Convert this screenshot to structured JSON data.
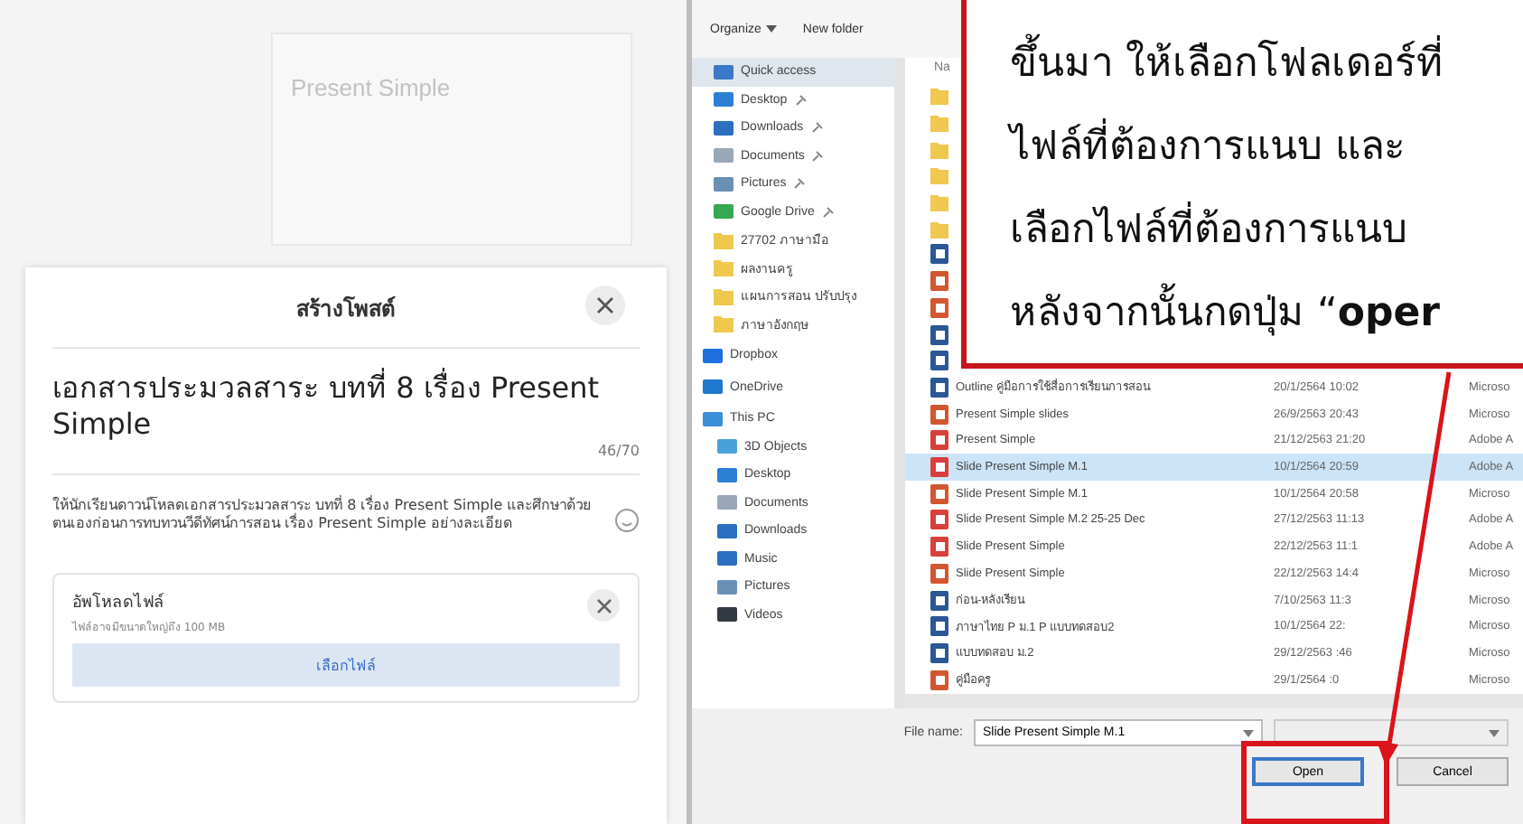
{
  "course_card": {
    "title": "Present Simple"
  },
  "post_dialog": {
    "title": "สร้างโพสต์",
    "post_title": "เอกสารประมวลสาระ บทที่ 8 เรื่อง Present Simple",
    "counter": "46/70",
    "description": "ให้นักเรียนดาวน์โหลดเอกสารประมวลสาระ บทที่ 8 เรื่อง Present Simple และศึกษาด้วยตนเองก่อนการทบทวนวีดีทัศน์การสอน เรื่อง Present Simple อย่างละเอียด",
    "attachment": {
      "title": "อัพโหลดไฟล์",
      "note": "ไฟล์อาจมีขนาดใหญ่ถึง 100 MB",
      "button": "เลือกไฟล์"
    }
  },
  "file_dialog": {
    "toolbar": {
      "organize": "Organize",
      "new_folder": "New folder"
    },
    "name_header": "Na",
    "sidebar": [
      {
        "label": "Quick access",
        "kind": "star",
        "selected": true,
        "pinned": false
      },
      {
        "label": "Desktop",
        "kind": "desktop",
        "selected": false,
        "pinned": true
      },
      {
        "label": "Downloads",
        "kind": "download",
        "selected": false,
        "pinned": true
      },
      {
        "label": "Documents",
        "kind": "documents",
        "selected": false,
        "pinned": true
      },
      {
        "label": "Pictures",
        "kind": "pictures",
        "selected": false,
        "pinned": true
      },
      {
        "label": "Google Drive",
        "kind": "drive",
        "selected": false,
        "pinned": true
      },
      {
        "label": "27702 ภาษามือ",
        "kind": "folder",
        "selected": false,
        "pinned": false
      },
      {
        "label": "ผลงานครู",
        "kind": "folder",
        "selected": false,
        "pinned": false
      },
      {
        "label": "แผนการสอน ปรับปรุง",
        "kind": "folder",
        "selected": false,
        "pinned": false
      },
      {
        "label": "ภาษาอังกฤษ",
        "kind": "folder",
        "selected": false,
        "pinned": false
      },
      {
        "label": "Dropbox",
        "kind": "dropbox",
        "selected": false,
        "pinned": false
      },
      {
        "label": "OneDrive",
        "kind": "cloud",
        "selected": false,
        "pinned": false
      },
      {
        "label": "This PC",
        "kind": "pc",
        "selected": false,
        "pinned": false
      },
      {
        "label": "3D Objects",
        "kind": "cube",
        "selected": false,
        "pinned": false
      },
      {
        "label": "Desktop",
        "kind": "desktop",
        "selected": false,
        "pinned": false
      },
      {
        "label": "Documents",
        "kind": "documents",
        "selected": false,
        "pinned": false
      },
      {
        "label": "Downloads",
        "kind": "download",
        "selected": false,
        "pinned": false
      },
      {
        "label": "Music",
        "kind": "music",
        "selected": false,
        "pinned": false
      },
      {
        "label": "Pictures",
        "kind": "pictures",
        "selected": false,
        "pinned": false
      },
      {
        "label": "Videos",
        "kind": "video",
        "selected": false,
        "pinned": false
      }
    ],
    "files": [
      {
        "kind": "folder",
        "selected": false
      },
      {
        "kind": "folder",
        "selected": false
      },
      {
        "kind": "folder",
        "selected": false
      },
      {
        "kind": "folder",
        "selected": false
      },
      {
        "kind": "folder",
        "selected": false
      },
      {
        "kind": "folder",
        "selected": false
      },
      {
        "kind": "word",
        "selected": false
      },
      {
        "kind": "ppt",
        "selected": false
      },
      {
        "kind": "ppt",
        "selected": false
      },
      {
        "kind": "word",
        "selected": false
      },
      {
        "kind": "word",
        "selected": false
      },
      {
        "kind": "word",
        "name": "Outline คู่มือการใช้สื่อการเรียนการสอน",
        "date": "20/1/2564 10:02",
        "type": "Microso",
        "selected": false
      },
      {
        "kind": "ppt",
        "name": "Present Simple slides",
        "date": "26/9/2563 20:43",
        "type": "Microso",
        "selected": false
      },
      {
        "kind": "pdf",
        "name": "Present Simple",
        "date": "21/12/2563 21:20",
        "type": "Adobe A",
        "selected": false
      },
      {
        "kind": "pdf",
        "name": "Slide Present Simple M.1",
        "date": "10/1/2564 20:59",
        "type": "Adobe A",
        "selected": true
      },
      {
        "kind": "ppt",
        "name": "Slide Present Simple M.1",
        "date": "10/1/2564 20:58",
        "type": "Microso",
        "selected": false
      },
      {
        "kind": "pdf",
        "name": "Slide Present Simple M.2 25-25 Dec",
        "date": "27/12/2563 11:13",
        "type": "Adobe A",
        "selected": false
      },
      {
        "kind": "pdf",
        "name": "Slide Present Simple",
        "date": "22/12/2563 11:1",
        "type": "Adobe A",
        "selected": false
      },
      {
        "kind": "ppt",
        "name": "Slide Present Simple",
        "date": "22/12/2563 14:4",
        "type": "Microso",
        "selected": false
      },
      {
        "kind": "word",
        "name": "ก่อน-หลังเรียน",
        "date": "7/10/2563 11:3",
        "type": "Microso",
        "selected": false
      },
      {
        "kind": "word",
        "name": "ภาษาไทย P ม.1 P แบบทดสอบ2",
        "date": "10/1/2564 22:",
        "type": "Microso",
        "selected": false
      },
      {
        "kind": "word",
        "name": "แบบทดสอบ ม.2",
        "date": "29/12/2563 :46",
        "type": "Microso",
        "selected": false
      },
      {
        "kind": "ppt",
        "name": "คู่มือครู",
        "date": "29/1/2564 :0",
        "type": "Microso",
        "selected": false
      }
    ],
    "file_name_label": "File name:",
    "file_name": "Slide Present Simple M.1",
    "buttons": {
      "open": "Open",
      "cancel": "Cancel"
    }
  },
  "callout": {
    "lines": [
      "ขึ้นมา ให้เลือกโฟลเดอร์ที่",
      "ไฟล์ที่ต้องการแนบ และ",
      "เลือกไฟล์ที่ต้องการแนบ",
      "หลังจากนั้นกดปุ่ม “**oper**"
    ]
  }
}
